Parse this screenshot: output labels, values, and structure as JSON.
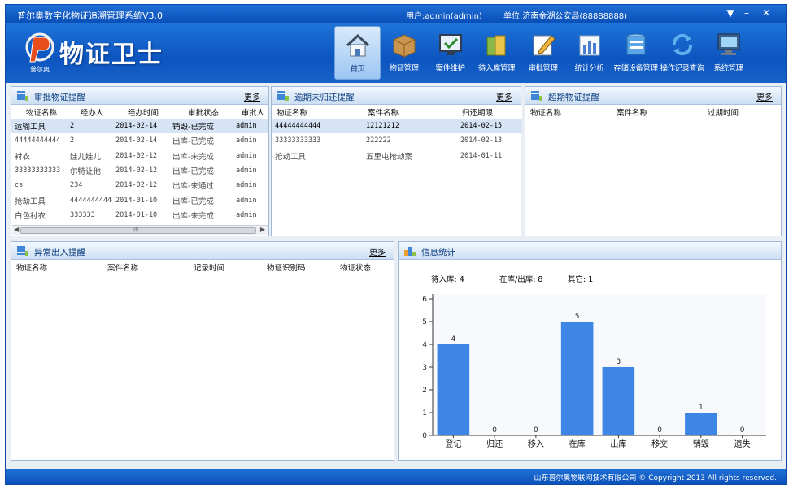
{
  "titlebar": {
    "app_title": "普尔奥数字化物证追溯管理系统V3.0",
    "user": "用户:admin(admin)",
    "unit": "单位:济南金湖公安局(88888888)",
    "dropdown_glyph": "▼",
    "minimize_glyph": "–",
    "close_glyph": "✕"
  },
  "header": {
    "logo_text": "物证卫士",
    "logo_sub": "普尔奥",
    "nav": [
      {
        "label": "首页",
        "icon": "house-icon",
        "active": true
      },
      {
        "label": "物证管理",
        "icon": "box-icon",
        "active": false
      },
      {
        "label": "案件维护",
        "icon": "monitor-check-icon",
        "active": false
      },
      {
        "label": "待入库管理",
        "icon": "folders-icon",
        "active": false
      },
      {
        "label": "审批管理",
        "icon": "edit-icon",
        "active": false
      },
      {
        "label": "统计分析",
        "icon": "bar-chart-icon",
        "active": false
      },
      {
        "label": "存储设备管理",
        "icon": "server-icon",
        "active": false
      },
      {
        "label": "操作记录查询",
        "icon": "refresh-icon",
        "active": false
      },
      {
        "label": "系统管理",
        "icon": "computer-icon",
        "active": false
      }
    ]
  },
  "approval_panel": {
    "title": "审批物证提醒",
    "more": "更多",
    "columns": [
      "物证名称",
      "经办人",
      "经办时间",
      "审批状态",
      "审批人"
    ],
    "rows": [
      [
        "运输工具",
        "2",
        "2014-02-14",
        "销毁-已完成",
        "admin"
      ],
      [
        "44444444444",
        "2",
        "2014-02-14",
        "出库-已完成",
        "admin"
      ],
      [
        "衬衣",
        "娃儿娃儿",
        "2014-02-12",
        "出库-未完成",
        "admin"
      ],
      [
        "33333333333",
        "尔特让他",
        "2014-02-12",
        "出库-已完成",
        "admin"
      ],
      [
        "cs",
        "234",
        "2014-02-12",
        "出库-未通过",
        "admin"
      ],
      [
        "抢劫工具",
        "44444444444",
        "2014-01-10",
        "出库-已完成",
        "admin"
      ],
      [
        "白色衬衣",
        "333333",
        "2014-01-10",
        "出库-未完成",
        "admin"
      ]
    ],
    "scroll_left": "◀",
    "scroll_right": "▶",
    "scroll_grip": "III"
  },
  "overdue_panel": {
    "title": "逾期未归还提醒",
    "more": "更多",
    "columns": [
      "物证名称",
      "案件名称",
      "归还期限"
    ],
    "rows": [
      [
        "44444444444",
        "12121212",
        "2014-02-15"
      ],
      [
        "33333333333",
        "222222",
        "2014-02-13"
      ],
      [
        "抢劫工具",
        "五里屯抢劫案",
        "2014-01-11"
      ]
    ]
  },
  "expired_panel": {
    "title": "超期物证提醒",
    "more": "更多",
    "columns": [
      "物证名称",
      "案件名称",
      "过期时间"
    ]
  },
  "abnormal_panel": {
    "title": "异常出入提醒",
    "more": "更多",
    "columns": [
      "物证名称",
      "案件名称",
      "记录时间",
      "物证识别码",
      "物证状态"
    ]
  },
  "stats_panel": {
    "title": "信息统计",
    "pending": "待入库: 4",
    "in_out": "在库/出库: 8",
    "other": "其它: 1"
  },
  "chart_data": {
    "type": "bar",
    "categories": [
      "登记",
      "归还",
      "移入",
      "在库",
      "出库",
      "移交",
      "销毁",
      "遗失"
    ],
    "values": [
      4,
      0,
      0,
      5,
      3,
      0,
      1,
      0
    ],
    "ylim": [
      0,
      6
    ],
    "yticks": [
      0,
      1,
      2,
      3,
      4,
      5,
      6
    ],
    "grid": false,
    "bar_color": "#3d86e6"
  },
  "statusbar": {
    "copyright": "山东普尔奥物联网技术有限公司 © Copyright 2013 All rights reserved."
  }
}
